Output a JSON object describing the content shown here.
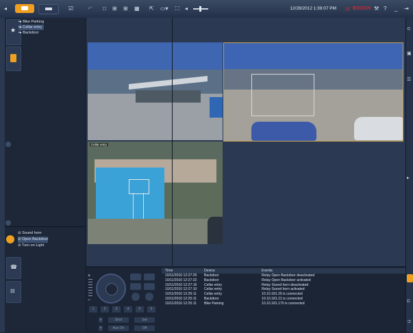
{
  "toolbar": {
    "datetime": "12/28/2012 1:39:07 PM",
    "brand": "BOSCH",
    "help_icon": "?",
    "minimize_icon": "_",
    "exit_icon": "⇥"
  },
  "tree": {
    "items": [
      {
        "label": "Bike Parking",
        "selected": false
      },
      {
        "label": "Cellar entry",
        "selected": true
      },
      {
        "label": "Backdoor",
        "selected": false
      }
    ]
  },
  "relays": {
    "items": [
      {
        "label": "Sound horn",
        "selected": false
      },
      {
        "label": "Open Backdoor",
        "selected": true
      },
      {
        "label": "Turn on Light",
        "selected": false
      }
    ]
  },
  "cameras": {
    "cam3_label": "Cellar entry"
  },
  "ptz": {
    "zoom_plus": "+",
    "zoom_minus": "−",
    "buttons": [
      "1",
      "2",
      "3",
      "4",
      "5",
      "6"
    ],
    "shot_label": "Shot",
    "set_label": "Set",
    "aux_on_label": "Aux On",
    "off_label": "Off"
  },
  "events": {
    "columns": [
      "Time",
      "Device",
      "Events"
    ],
    "rows": [
      {
        "time": "10/11/2010 12:27:25",
        "device": "Backdoor",
        "event": "Relay Open Backdoor deactivated"
      },
      {
        "time": "10/11/2010 12:27:22",
        "device": "Backdoor",
        "event": "Relay Open Backdoor activated"
      },
      {
        "time": "10/11/2010 12:27:16",
        "device": "Cellar entry",
        "event": "Relay Sound horn deactivated"
      },
      {
        "time": "10/11/2010 12:27:10",
        "device": "Cellar entry",
        "event": "Relay Sound horn activated"
      },
      {
        "time": "10/11/2010 12:25:11",
        "device": "Cellar entry",
        "event": "10.10.181.20 is connected"
      },
      {
        "time": "10/11/2010 12:25:11",
        "device": "Backdoor",
        "event": "10.10.181.21 is connected"
      },
      {
        "time": "10/11/2010 12:25:11",
        "device": "Bike Parking",
        "event": "10.10.181.170 is connected"
      }
    ]
  },
  "colors": {
    "accent_orange": "#f0a020",
    "brand_red": "#d9262c",
    "selection_border": "#c8a050"
  }
}
